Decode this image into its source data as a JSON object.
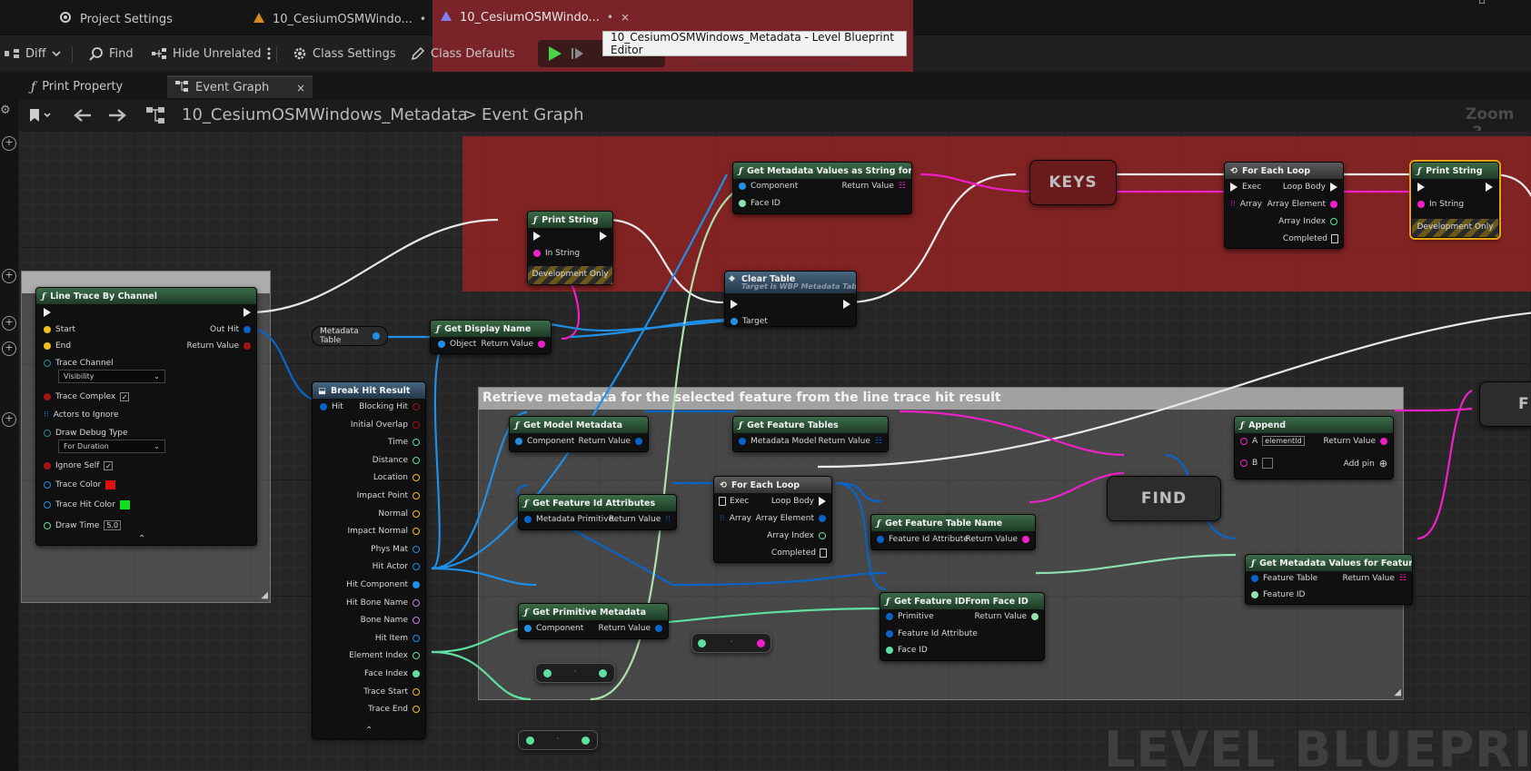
{
  "window": {
    "tabs": [
      {
        "label": "Project Settings",
        "icon": "gear-icon"
      },
      {
        "label": "10_CesiumOSMWindo...",
        "modified": "•",
        "icon": "level-icon"
      },
      {
        "label": "10_CesiumOSMWindo...",
        "modified": "•",
        "close": "×",
        "icon": "blueprint-icon"
      }
    ],
    "tooltip": "10_CesiumOSMWindows_Metadata - Level Blueprint Editor"
  },
  "toolbar": {
    "diff": "Diff",
    "find": "Find",
    "hide_unrelated": "Hide Unrelated",
    "class_settings": "Class Settings",
    "class_defaults": "Class Defaults"
  },
  "doc_tabs": [
    {
      "label": "Print Property",
      "icon": "function-icon"
    },
    {
      "label": "Event Graph",
      "icon": "graph-icon",
      "close": "×"
    }
  ],
  "breadcrumb": {
    "level": "10_CesiumOSMWindows_Metadata",
    "separator": ">",
    "graph": "Event Graph",
    "zoom": "Zoom -3"
  },
  "comments": {
    "gray": "Retrieve metadata for the selected feature from the line trace hit result"
  },
  "watermark": "LEVEL BLUEPRINT",
  "nodes": {
    "line_trace": {
      "title": "Line Trace By Channel",
      "start": "Start",
      "end": "End",
      "out_hit": "Out Hit",
      "return_value": "Return Value",
      "trace_channel": "Trace Channel",
      "trace_channel_value": "Visibility",
      "trace_complex": "Trace Complex",
      "actors_to_ignore": "Actors to Ignore",
      "draw_debug_type": "Draw Debug Type",
      "draw_debug_value": "For Duration",
      "ignore_self": "Ignore Self",
      "trace_color": "Trace Color",
      "trace_hit_color": "Trace Hit Color",
      "draw_time": "Draw Time",
      "draw_time_value": "5.0",
      "check": "✓",
      "expand": "⌃",
      "trace_color_hex": "#e01010",
      "trace_hit_color_hex": "#10e020"
    },
    "metadata_table": {
      "label": "Metadata Table"
    },
    "get_display_name": {
      "title": "Get Display Name",
      "object": "Object",
      "return_value": "Return Value"
    },
    "break_hit": {
      "title": "Break Hit Result",
      "hit": "Hit",
      "outputs": [
        "Blocking Hit",
        "Initial Overlap",
        "Time",
        "Distance",
        "Location",
        "Impact Point",
        "Normal",
        "Impact Normal",
        "Phys Mat",
        "Hit Actor",
        "Hit Component",
        "Hit Bone Name",
        "Bone Name",
        "Hit Item",
        "Element Index",
        "Face Index",
        "Trace Start",
        "Trace End"
      ],
      "expand": "⌃"
    },
    "print_string_1": {
      "title": "Print String",
      "in_string": "In String",
      "dev_only": "Development Only"
    },
    "clear_table": {
      "title": "Clear Table",
      "subtitle": "Target is WBP Metadata Table",
      "target": "Target"
    },
    "get_metadata_values_face": {
      "title": "Get Metadata Values as String for Face",
      "component": "Component",
      "face_id": "Face ID",
      "return_value": "Return Value"
    },
    "keys": {
      "label": "KEYS"
    },
    "for_each_1": {
      "title": "For Each Loop",
      "exec": "Exec",
      "array": "Array",
      "loop_body": "Loop Body",
      "array_element": "Array Element",
      "array_index": "Array Index",
      "completed": "Completed"
    },
    "print_string_2": {
      "title": "Print String",
      "in_string": "In String",
      "dev_only": "Development Only"
    },
    "get_model_metadata": {
      "title": "Get Model Metadata",
      "component": "Component",
      "return_value": "Return Value"
    },
    "get_feature_tables": {
      "title": "Get Feature Tables",
      "metadata_model": "Metadata Model",
      "return_value": "Return Value"
    },
    "get_feature_id_attributes": {
      "title": "Get Feature Id Attributes",
      "metadata_primitive": "Metadata Primitive",
      "return_value": "Return Value"
    },
    "for_each_2": {
      "title": "For Each Loop",
      "exec": "Exec",
      "array": "Array",
      "loop_body": "Loop Body",
      "array_element": "Array Element",
      "array_index": "Array Index",
      "completed": "Completed"
    },
    "get_feature_table_name": {
      "title": "Get Feature Table Name",
      "feature_id_attribute": "Feature Id Attribute",
      "return_value": "Return Value"
    },
    "find_1": {
      "label": "FIND"
    },
    "append": {
      "title": "Append",
      "a": "A",
      "a_value": "elementId",
      "b": "B",
      "return_value": "Return Value",
      "add_pin": "Add pin"
    },
    "find_2": {
      "label": "FIND"
    },
    "get_metadata_values_feature": {
      "title": "Get Metadata Values for Feature ID",
      "feature_table": "Feature Table",
      "feature_id": "Feature ID",
      "return_value": "Return Value"
    },
    "get_primitive_metadata": {
      "title": "Get Primitive Metadata",
      "component": "Component",
      "return_value": "Return Value"
    },
    "get_feature_id_from_face": {
      "title": "Get Feature IDFrom Face ID",
      "primitive": "Primitive",
      "feature_id_attribute": "Feature Id Attribute",
      "face_id": "Face ID",
      "return_value": "Return Value"
    },
    "reroute_mid": "·"
  },
  "colors": {
    "exec": "#ffffff",
    "object": "#1f8fe8",
    "string": "#f020c8",
    "integer": "#60e0a0",
    "struct": "#0a64c8",
    "boolean": "#a01414",
    "vector": "#f0c020",
    "name": "#c080f0",
    "comment_red": "#a52323"
  }
}
